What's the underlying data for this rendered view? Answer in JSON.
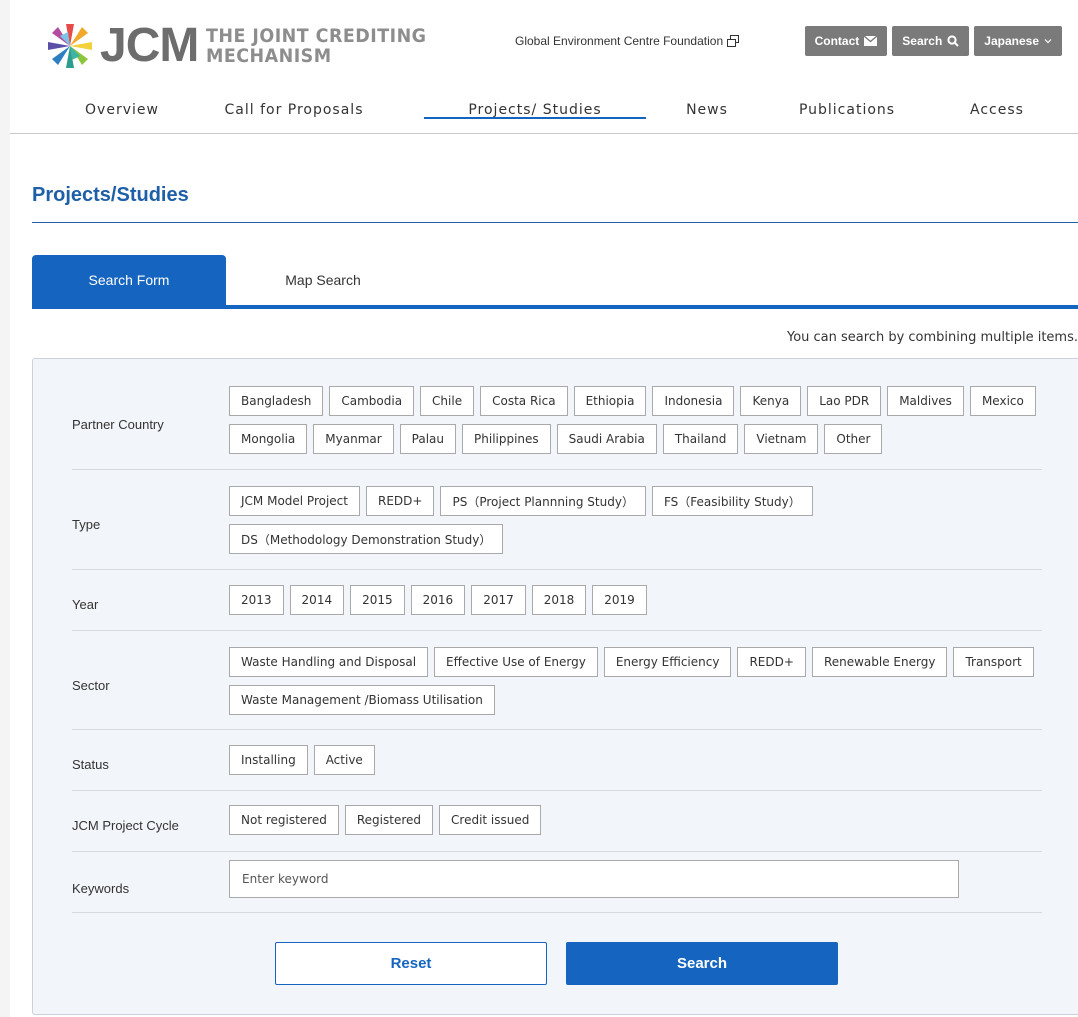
{
  "header": {
    "logo_text": "JCM",
    "logo_subtitle_1": "THE JOINT CREDITING",
    "logo_subtitle_2": "MECHANISM",
    "foundation_link": "Global Environment Centre Foundation",
    "buttons": {
      "contact": "Contact",
      "search": "Search",
      "language": "Japanese"
    }
  },
  "nav": [
    {
      "label": "Overview"
    },
    {
      "label": "Call for Proposals"
    },
    {
      "label": "Projects/ Studies"
    },
    {
      "label": "News"
    },
    {
      "label": "Publications"
    },
    {
      "label": "Access"
    }
  ],
  "page_title": "Projects/Studies",
  "tabs": {
    "search_form": "Search Form",
    "map_search": "Map Search"
  },
  "hint": "You can search by combining multiple items.",
  "filters": {
    "partner_country": {
      "label": "Partner Country",
      "options": [
        "Bangladesh",
        "Cambodia",
        "Chile",
        "Costa Rica",
        "Ethiopia",
        "Indonesia",
        "Kenya",
        "Lao PDR",
        "Maldives",
        "Mexico",
        "Mongolia",
        "Myanmar",
        "Palau",
        "Philippines",
        "Saudi Arabia",
        "Thailand",
        "Vietnam",
        "Other"
      ]
    },
    "type": {
      "label": "Type",
      "options": [
        "JCM Model Project",
        "REDD+",
        "PS（Project Plannning Study）",
        "FS（Feasibility Study）",
        "DS（Methodology Demonstration Study）"
      ]
    },
    "year": {
      "label": "Year",
      "options": [
        "2013",
        "2014",
        "2015",
        "2016",
        "2017",
        "2018",
        "2019"
      ]
    },
    "sector": {
      "label": "Sector",
      "options": [
        "Waste Handling and Disposal",
        "Effective Use of Energy",
        "Energy Efficiency",
        "REDD+",
        "Renewable Energy",
        "Transport",
        "Waste Management /Biomass Utilisation"
      ]
    },
    "status": {
      "label": "Status",
      "options": [
        "Installing",
        "Active"
      ]
    },
    "cycle": {
      "label": "JCM Project Cycle",
      "options": [
        "Not registered",
        "Registered",
        "Credit issued"
      ]
    },
    "keywords": {
      "label": "Keywords",
      "placeholder": "Enter keyword",
      "value": ""
    }
  },
  "actions": {
    "reset": "Reset",
    "search": "Search"
  },
  "colors": {
    "primary": "#1565c0",
    "title": "#1e5fa8",
    "header_button": "#7a7a7a"
  }
}
